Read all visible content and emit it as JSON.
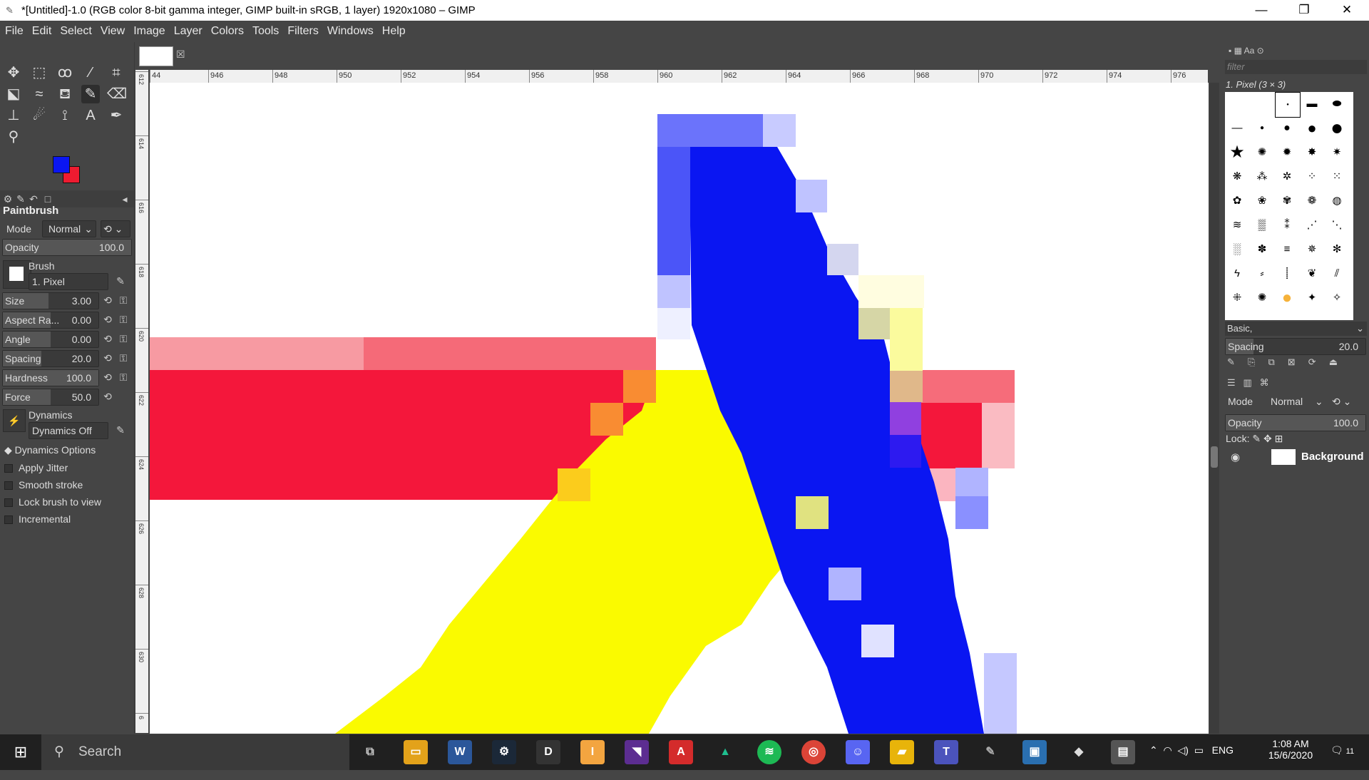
{
  "window": {
    "title": "*[Untitled]-1.0 (RGB color 8-bit gamma integer, GIMP built-in sRGB, 1 layer) 1920x1080 – GIMP",
    "minimize": "—",
    "maximize": "❐",
    "close": "✕"
  },
  "menu": [
    "File",
    "Edit",
    "Select",
    "View",
    "Image",
    "Layer",
    "Colors",
    "Tools",
    "Filters",
    "Windows",
    "Help"
  ],
  "colors": {
    "foreground": "#0a16f2",
    "background": "#ee1b30"
  },
  "tool_options": {
    "title": "Paintbrush",
    "mode_label": "Mode",
    "mode_value": "Normal",
    "opacity_label": "Opacity",
    "opacity_value": "100.0",
    "brush_label": "Brush",
    "brush_value": "1. Pixel",
    "size_label": "Size",
    "size_value": "3.00",
    "aspect_label": "Aspect Ra...",
    "aspect_value": "0.00",
    "angle_label": "Angle",
    "angle_value": "0.00",
    "spacing_label": "Spacing",
    "spacing_value": "20.0",
    "hardness_label": "Hardness",
    "hardness_value": "100.0",
    "force_label": "Force",
    "force_value": "50.0",
    "dynamics_label": "Dynamics",
    "dynamics_value": "Dynamics Off",
    "dynamics_options": "Dynamics Options",
    "apply_jitter": "Apply Jitter",
    "smooth_stroke": "Smooth stroke",
    "lock_brush": "Lock brush to view",
    "incremental": "Incremental"
  },
  "ruler": {
    "h_labels": [
      "44",
      "946",
      "948",
      "950",
      "952",
      "954",
      "956",
      "958",
      "960",
      "962",
      "964",
      "966",
      "968",
      "970",
      "972",
      "974",
      "976"
    ],
    "v_labels": [
      "612",
      "614",
      "616",
      "618",
      "620",
      "622",
      "624",
      "626",
      "628",
      "630",
      "6"
    ]
  },
  "brushes": {
    "filter_placeholder": "filter",
    "selected": "1. Pixel (3 × 3)",
    "preset": "Basic,",
    "spacing_label": "Spacing",
    "spacing_value": "20.0"
  },
  "layers": {
    "mode_label": "Mode",
    "mode_value": "Normal",
    "opacity_label": "Opacity",
    "opacity_value": "100.0",
    "lock_label": "Lock:",
    "layer_name": "Background"
  },
  "taskbar": {
    "search": "Search",
    "time": "1:08 AM",
    "date": "15/6/2020",
    "lang": "ENG",
    "notifications": "11"
  }
}
